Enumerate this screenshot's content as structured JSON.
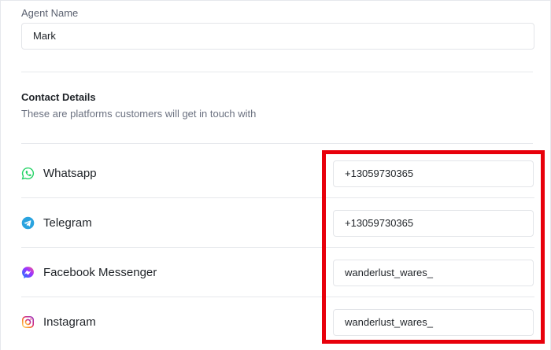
{
  "agent": {
    "label": "Agent Name",
    "value": "Mark"
  },
  "contact": {
    "title": "Contact Details",
    "subtitle": "These are platforms customers will get in touch with",
    "platforms": [
      {
        "label": "Whatsapp",
        "value": "+13059730365",
        "icon": "whatsapp-icon",
        "color": "#25d366"
      },
      {
        "label": "Telegram",
        "value": "+13059730365",
        "icon": "telegram-icon",
        "color": "#2aa3df"
      },
      {
        "label": "Facebook Messenger",
        "value": "wanderlust_wares_",
        "icon": "messenger-icon",
        "color": "#8a3ffc"
      },
      {
        "label": "Instagram",
        "value": "wanderlust_wares_",
        "icon": "instagram-icon",
        "color": "#d6249f"
      }
    ]
  },
  "highlight": {
    "color": "#e8000b"
  }
}
